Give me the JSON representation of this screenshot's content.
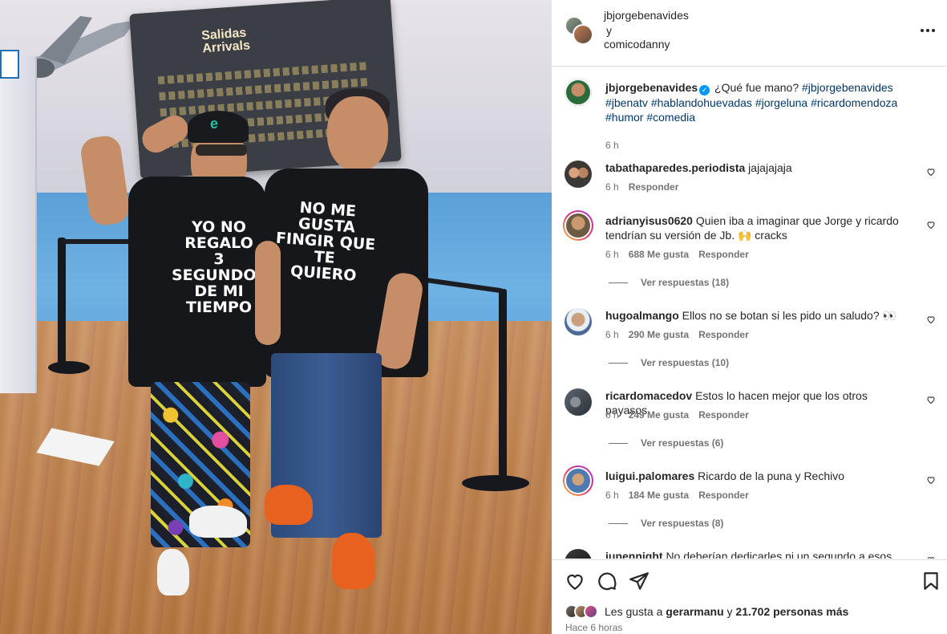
{
  "post_image": {
    "board_title": "Salidas\nArrivals",
    "shirt_left_text": "YO NO REGALO\n3 SEGUNDOS\nDE MI TIEMPO",
    "shirt_right_text": "NO ME GUSTA\nFINGIR QUE TE\nQUIERO",
    "cap_logo": "e"
  },
  "header": {
    "user1": "jbjorgebenavides",
    "conjunction": "y",
    "user2": "comicodanny"
  },
  "caption": {
    "user": "jbjorgebenavides",
    "text": "¿Qué fue mano?",
    "hashtags_line1": "#jbjorgebenavides",
    "hashtags_line2": "#jbenatv #hablandohuevadas #jorgeluna #ricardomendoza",
    "hashtags_line3": "#humor #comedia",
    "time": "6 h"
  },
  "comments": [
    {
      "user": "tabathaparedes.periodista",
      "text": "jajajajaja",
      "time": "6 h",
      "likes": "",
      "reply": "Responder",
      "view_replies": ""
    },
    {
      "user": "adrianyisus0620",
      "text": "Quien iba a imaginar que Jorge y ricardo tendrían su versión de Jb. 🙌 cracks",
      "time": "6 h",
      "likes": "688 Me gusta",
      "reply": "Responder",
      "view_replies": "Ver respuestas (18)"
    },
    {
      "user": "hugoalmango",
      "text": "Ellos no se botan si les pido un saludo? 👀",
      "time": "6 h",
      "likes": "290 Me gusta",
      "reply": "Responder",
      "view_replies": "Ver respuestas (10)"
    },
    {
      "user": "ricardomacedov",
      "text": "Estos lo hacen mejor que los otros payasos",
      "time": "6 h",
      "likes": "249 Me gusta",
      "reply": "Responder",
      "view_replies": "Ver respuestas (6)"
    },
    {
      "user": "luigui.palomares",
      "text": "Ricardo de la puna y Rechivo",
      "time": "6 h",
      "likes": "184 Me gusta",
      "reply": "Responder",
      "view_replies": "Ver respuestas (8)"
    },
    {
      "user": "junennight",
      "text": "No deberían dedicarles ni un segundo a esos",
      "time": "",
      "likes": "",
      "reply": "",
      "view_replies": ""
    }
  ],
  "likes": {
    "prefix": "Les gusta a",
    "user": "gerarmanu",
    "conj": "y",
    "others": "21.702 personas más"
  },
  "posted": "Hace 6 horas",
  "icons": [
    "more-icon",
    "verified-icon",
    "heart-icon",
    "comment-icon",
    "share-icon",
    "bookmark-icon"
  ],
  "colors": {
    "link": "#00376b",
    "verified": "#0095f6",
    "meta": "#737373"
  }
}
